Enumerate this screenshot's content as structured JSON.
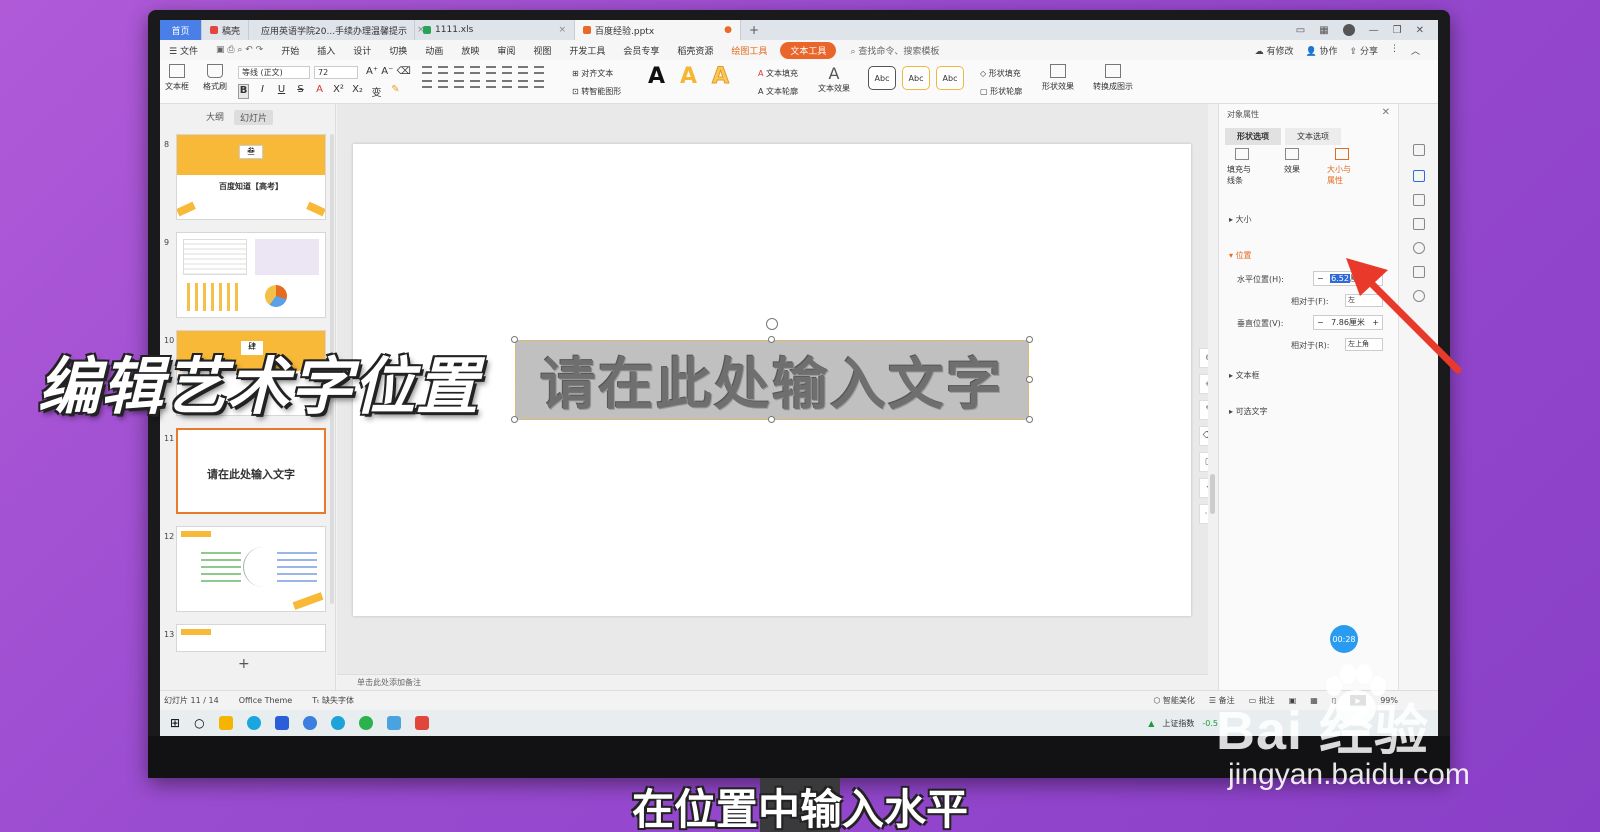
{
  "tabs": [
    {
      "label": "首页"
    },
    {
      "label": "稿壳"
    },
    {
      "label": "应用英语学院20...手续办理温馨提示"
    },
    {
      "label": "1111.xls"
    },
    {
      "label": "百度经验.pptx"
    }
  ],
  "menu": {
    "file": "文件",
    "items": [
      "开始",
      "插入",
      "设计",
      "切换",
      "动画",
      "放映",
      "审阅",
      "视图",
      "开发工具",
      "会员专享",
      "稻壳资源"
    ],
    "drawing_tools": "绘图工具",
    "text_tools": "文本工具",
    "search": "查找命令、搜索模板",
    "has_changes": "有修改",
    "collab": "协作",
    "share": "分享"
  },
  "ribbon": {
    "textbox": "文本框",
    "format_brush": "格式刷",
    "font": "等线 (正文)",
    "size": "72",
    "align_text": "对齐文本",
    "smart_shape": "转智能图形",
    "text_fill": "文本填充",
    "text_outline": "文本轮廓",
    "text_effect": "文本效果",
    "style_sample": "Abc",
    "shape_fill": "形状填充",
    "shape_outline": "形状轮廓",
    "shape_effect": "形状效果",
    "convert": "转换成图示"
  },
  "left_pane": {
    "tab_outline": "大纲",
    "tab_slides": "幻灯片",
    "slides": [
      {
        "num": "8",
        "title": "百度知道【高考】",
        "badge": "叁"
      },
      {
        "num": "9"
      },
      {
        "num": "10",
        "badge": "肆"
      },
      {
        "num": "11",
        "title": "请在此处输入文字"
      },
      {
        "num": "12"
      },
      {
        "num": "13"
      }
    ]
  },
  "canvas": {
    "wordart_text": "请在此处输入文字",
    "notes": "单击此处添加备注"
  },
  "property_panel": {
    "title": "对象属性",
    "tab_shape": "形状选项",
    "tab_text": "文本选项",
    "icon_fill": "填充与线条",
    "icon_effect": "效果",
    "icon_size": "大小与属性",
    "sec_size": "大小",
    "sec_position": "位置",
    "h_label": "水平位置(H):",
    "h_value": "6.52",
    "h_unit": "厘米",
    "rel_f": "相对于(F):",
    "rel_f_val": "左",
    "v_label": "垂直位置(V):",
    "v_value": "7.86厘米",
    "rel_r": "相对于(R):",
    "rel_r_val": "左上角",
    "sec_textbox": "文本框",
    "sec_alt": "可选文字",
    "timer": "00:28"
  },
  "status": {
    "slide_count": "幻灯片 11 / 14",
    "theme": "Office Theme",
    "missing_font": "缺失字体",
    "beautify": "智能美化",
    "notes": "备注",
    "comments": "批注",
    "zoom": "99%"
  },
  "taskbar": {
    "index_label": "上证指数",
    "index_value": "-0.5"
  },
  "overlay": {
    "title": "编辑艺术字位置",
    "caption": "在位置中输入水平"
  },
  "watermark": {
    "brand": "Bai 经验",
    "url": "jingyan.baidu.com"
  }
}
